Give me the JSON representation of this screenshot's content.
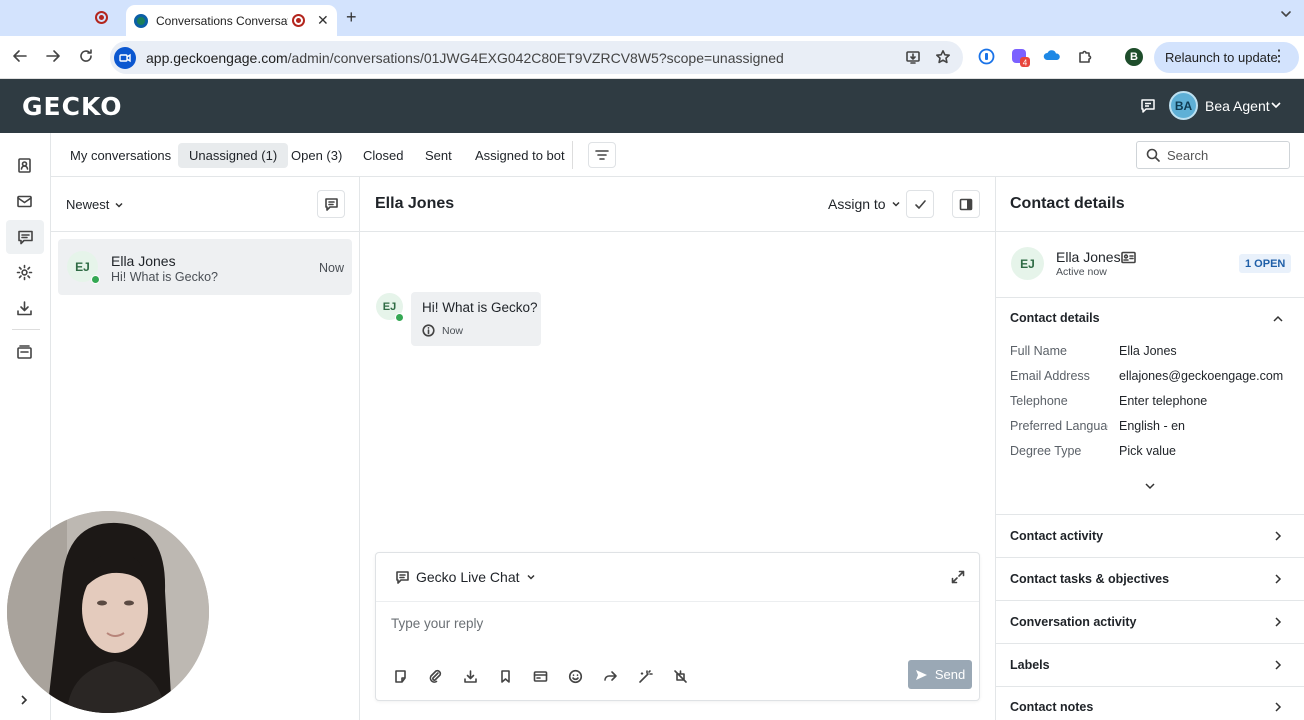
{
  "browser": {
    "tab_title": "Conversations Conversations",
    "url_host": "app.geckoengage.com",
    "url_path": "/admin/conversations/01JWG4EXG042C80ET9VZRCV8W5?scope=unassigned",
    "profile_initial": "B",
    "extension_badge": "4",
    "relaunch_label": "Relaunch to update"
  },
  "header": {
    "logo": "GECKO",
    "agent_initials": "BA",
    "agent_name": "Bea Agent"
  },
  "filters": {
    "tabs": [
      {
        "label": "My conversations"
      },
      {
        "label": "Unassigned (1)"
      },
      {
        "label": "Open (3)"
      },
      {
        "label": "Closed"
      },
      {
        "label": "Sent"
      },
      {
        "label": "Assigned to bot"
      }
    ],
    "search_placeholder": "Search"
  },
  "conversation_list": {
    "sort_label": "Newest",
    "items": [
      {
        "initials": "EJ",
        "name": "Ella Jones",
        "snippet": "Hi! What is Gecko?",
        "time": "Now"
      }
    ]
  },
  "chat": {
    "title": "Ella Jones",
    "assign_label": "Assign to",
    "messages": [
      {
        "initials": "EJ",
        "text": "Hi! What is Gecko?",
        "time": "Now"
      }
    ],
    "composer": {
      "channel": "Gecko Live Chat",
      "placeholder": "Type your reply",
      "send_label": "Send"
    }
  },
  "details": {
    "title": "Contact details",
    "contact": {
      "initials": "EJ",
      "name": "Ella Jones",
      "status": "Active now",
      "open_badge": "1 OPEN"
    },
    "section_title": "Contact details",
    "fields": [
      {
        "label": "Full Name",
        "value": "Ella Jones"
      },
      {
        "label": "Email Address",
        "value": "ellajones@geckoengage.com"
      },
      {
        "label": "Telephone",
        "value": "Enter telephone"
      },
      {
        "label": "Preferred Language",
        "value": "English - en"
      },
      {
        "label": "Degree Type",
        "value": "Pick value"
      }
    ],
    "sections": [
      {
        "label": "Contact activity"
      },
      {
        "label": "Contact tasks & objectives"
      },
      {
        "label": "Conversation activity"
      },
      {
        "label": "Labels"
      },
      {
        "label": "Contact notes"
      }
    ]
  },
  "colors": {
    "header_bg": "#2f3b42",
    "send_disabled": "#9aa8b5",
    "online": "#34a853",
    "badge_text": "#1f5fa8"
  }
}
